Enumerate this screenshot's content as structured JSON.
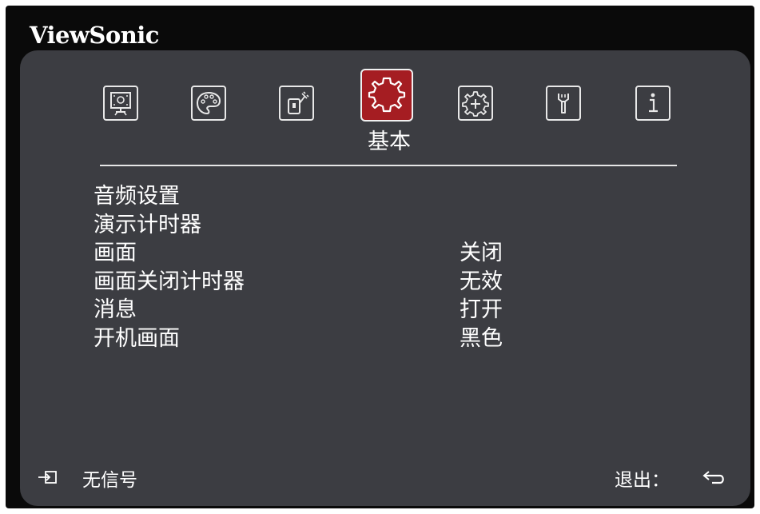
{
  "brand": "ViewSonic",
  "tabs": [
    {
      "icon": "display-icon",
      "active": false
    },
    {
      "icon": "palette-icon",
      "active": false
    },
    {
      "icon": "power-plug-icon",
      "active": false
    },
    {
      "icon": "gear-icon",
      "active": true,
      "label": "基本"
    },
    {
      "icon": "advanced-gear-icon",
      "active": false
    },
    {
      "icon": "wrench-icon",
      "active": false
    },
    {
      "icon": "info-icon",
      "active": false
    }
  ],
  "menu": {
    "items": [
      {
        "label": "音频设置",
        "value": ""
      },
      {
        "label": "演示计时器",
        "value": ""
      },
      {
        "label": "画面",
        "value": "关闭"
      },
      {
        "label": "画面关闭计时器",
        "value": "无效"
      },
      {
        "label": "消息",
        "value": "打开"
      },
      {
        "label": "开机画面",
        "value": "黑色"
      }
    ]
  },
  "footer": {
    "source_status": "无信号",
    "exit_label": "退出："
  },
  "colors": {
    "frame": "#0a0a0a",
    "panel": "#3c3d42",
    "active_tab": "#a51d22",
    "text": "#ffffff"
  }
}
